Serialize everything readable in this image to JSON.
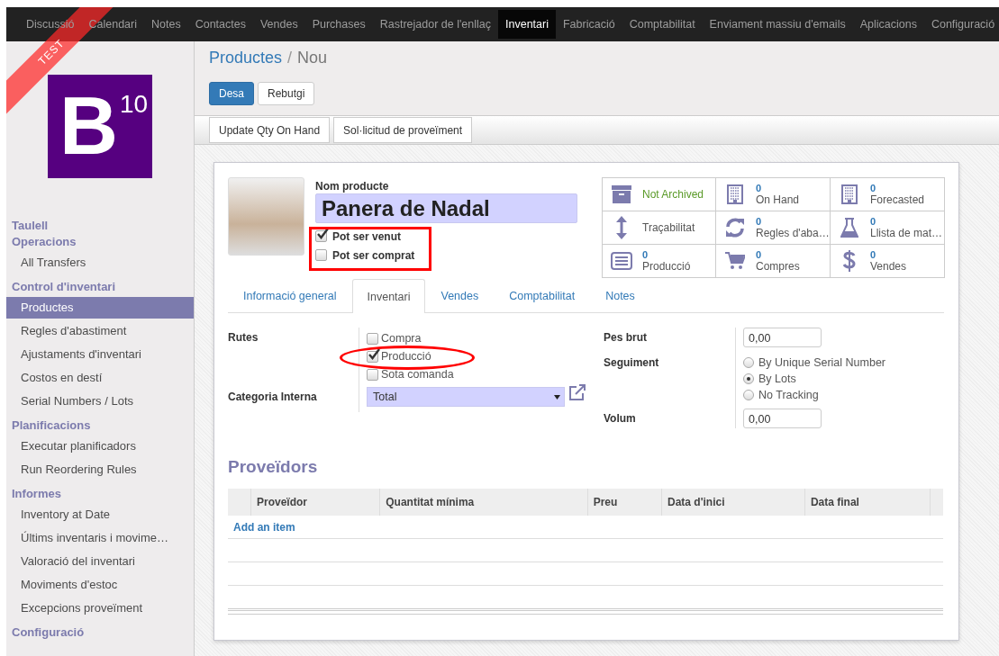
{
  "ribbon": {
    "text": "TEST"
  },
  "top_menu": [
    {
      "label": "Discussió",
      "selected": false
    },
    {
      "label": "Calendari",
      "selected": false
    },
    {
      "label": "Notes",
      "selected": false
    },
    {
      "label": "Contactes",
      "selected": false
    },
    {
      "label": "Vendes",
      "selected": false
    },
    {
      "label": "Purchases",
      "selected": false
    },
    {
      "label": "Rastrejador de l'enllaç",
      "selected": false
    },
    {
      "label": "Inventari",
      "selected": true
    },
    {
      "label": "Fabricació",
      "selected": false
    },
    {
      "label": "Comptabilitat",
      "selected": false
    },
    {
      "label": "Enviament massiu d'emails",
      "selected": false
    },
    {
      "label": "Aplicacions",
      "selected": false
    },
    {
      "label": "Configuració",
      "selected": false
    }
  ],
  "logo": {
    "letter": "B",
    "superscript": "10"
  },
  "sidebar": {
    "sections": [
      {
        "title": "Taulell"
      },
      {
        "title": "Operacions",
        "items": [
          {
            "label": "All Transfers",
            "selected": false
          }
        ]
      },
      {
        "title": "Control d'inventari",
        "items": [
          {
            "label": "Productes",
            "selected": true
          },
          {
            "label": "Regles d'abastiment",
            "selected": false
          },
          {
            "label": "Ajustaments d'inventari",
            "selected": false
          },
          {
            "label": "Costos en destí",
            "selected": false
          },
          {
            "label": "Serial Numbers / Lots",
            "selected": false
          }
        ]
      },
      {
        "title": "Planificacions",
        "items": [
          {
            "label": "Executar planificadors",
            "selected": false
          },
          {
            "label": "Run Reordering Rules",
            "selected": false
          }
        ]
      },
      {
        "title": "Informes",
        "items": [
          {
            "label": "Inventory at Date",
            "selected": false
          },
          {
            "label": "Últims inventaris i movime…",
            "selected": false
          },
          {
            "label": "Valoració del inventari",
            "selected": false
          },
          {
            "label": "Moviments d'estoc",
            "selected": false
          },
          {
            "label": "Excepcions proveïment",
            "selected": false
          }
        ]
      },
      {
        "title": "Configuració"
      }
    ]
  },
  "breadcrumb": {
    "items": [
      "Productes",
      "Nou"
    ],
    "separator": "/"
  },
  "buttons": [
    {
      "label": "Desa",
      "kind": "primary"
    },
    {
      "label": "Rebutgi",
      "kind": "default"
    }
  ],
  "action_buttons": [
    "Update Qty On Hand",
    "Sol·licitud de proveïment"
  ],
  "product": {
    "name_label": "Nom producte",
    "name": "Panera de Nadal",
    "options": [
      {
        "label": "Pot ser venut",
        "checked": true
      },
      {
        "label": "Pot ser comprat",
        "checked": false
      }
    ]
  },
  "smart_buttons": [
    {
      "kind": "archive",
      "label": "Not Archived"
    },
    {
      "kind": "building",
      "value": "0",
      "label": "On Hand"
    },
    {
      "kind": "building",
      "value": "0",
      "label": "Forecasted"
    },
    {
      "kind": "arrows",
      "label": "Traçabilitat"
    },
    {
      "kind": "refresh",
      "value": "0",
      "label": "Regles d'aba…"
    },
    {
      "kind": "flask",
      "value": "0",
      "label": "Llista de mat…"
    },
    {
      "kind": "list",
      "value": "0",
      "label": "Producció"
    },
    {
      "kind": "cart",
      "value": "0",
      "label": "Compres"
    },
    {
      "kind": "dollar",
      "value": "0",
      "label": "Vendes"
    }
  ],
  "tabs": [
    {
      "label": "Informació general",
      "selected": false
    },
    {
      "label": "Inventari",
      "selected": true
    },
    {
      "label": "Vendes",
      "selected": false
    },
    {
      "label": "Comptabilitat",
      "selected": false
    },
    {
      "label": "Notes",
      "selected": false
    }
  ],
  "inventory": {
    "routes_label": "Rutes",
    "routes": [
      {
        "label": "Compra",
        "checked": false
      },
      {
        "label": "Producció",
        "checked": true
      },
      {
        "label": "Sota comanda",
        "checked": false
      }
    ],
    "category_label": "Categoria Interna",
    "category": "Total",
    "weight_label": "Pes brut",
    "weight": "0,00",
    "tracking_label": "Seguiment",
    "tracking": [
      {
        "label": "By Unique Serial Number",
        "selected": false
      },
      {
        "label": "By Lots",
        "selected": true
      },
      {
        "label": "No Tracking",
        "selected": false
      }
    ],
    "volume_label": "Volum",
    "volume": "0,00"
  },
  "suppliers": {
    "title": "Proveïdors",
    "columns": [
      "Proveïdor",
      "Quantitat mínima",
      "Preu",
      "Data d'inici",
      "Data final"
    ],
    "add_item": "Add an item"
  },
  "annotations": [
    {
      "kind": "rectangle"
    },
    {
      "kind": "ellipse"
    }
  ]
}
